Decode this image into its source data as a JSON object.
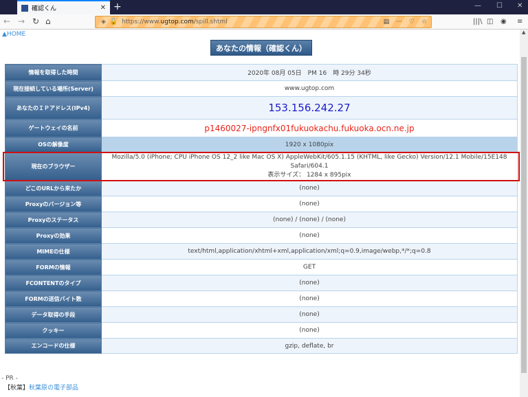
{
  "browser": {
    "tab_title": "確認くん",
    "url_prefix": "https://www.",
    "url_domain": "ugtop.com",
    "url_path": "/spill.shtml"
  },
  "page": {
    "home_link": "▲HOME",
    "heading": "あなたの情報（確認くん）",
    "rows": [
      {
        "label": "情報を取得した時間",
        "value": "2020年 08月 05日　PM 16　時 29分 34秒"
      },
      {
        "label": "現在接続している場所(Server)",
        "value": "www.ugtop.com"
      },
      {
        "label": "あなたのＩＰアドレス(IPv4)",
        "value": "153.156.242.27"
      },
      {
        "label": "ゲートウェイの名前",
        "value": "p1460027-ipngnfx01fukuokachu.fukuoka.ocn.ne.jp"
      },
      {
        "label": "OSの解像度",
        "value": "1920 x 1080pix"
      },
      {
        "label": "現在のブラウザー",
        "value": "Mozilla/5.0 (iPhone; CPU iPhone OS 12_2 like Mac OS X) AppleWebKit/605.1.15 (KHTML, like Gecko) Version/12.1 Mobile/15E148 Safari/604.1",
        "value2": "表示サイズ： 1284 x 895pix"
      },
      {
        "label": "どこのURLから来たか",
        "value": "(none)"
      },
      {
        "label": "Proxyのバージョン等",
        "value": "(none)"
      },
      {
        "label": "Proxyのステータス",
        "value": "(none) / (none) / (none)"
      },
      {
        "label": "Proxyの効果",
        "value": "(none)"
      },
      {
        "label": "MIMEの仕様",
        "value": "text/html,application/xhtml+xml,application/xml;q=0.9,image/webp,*/*;q=0.8"
      },
      {
        "label": "FORMの情報",
        "value": "GET"
      },
      {
        "label": "FCONTENTのタイプ",
        "value": "(none)"
      },
      {
        "label": "FORMの送信バイト数",
        "value": "(none)"
      },
      {
        "label": "データ取得の手段",
        "value": "(none)"
      },
      {
        "label": "クッキー",
        "value": "(none)"
      },
      {
        "label": "エンコードの仕様",
        "value": "gzip, deflate, br"
      }
    ],
    "pr_label": "- PR -",
    "pr_prefix": "【秋葉】",
    "pr_link": "秋葉原の電子部品"
  },
  "colors": {
    "highlight": "#d10f0f",
    "ip": "#1a1acc",
    "gateway": "#e8231a",
    "header": "#345f8d"
  }
}
